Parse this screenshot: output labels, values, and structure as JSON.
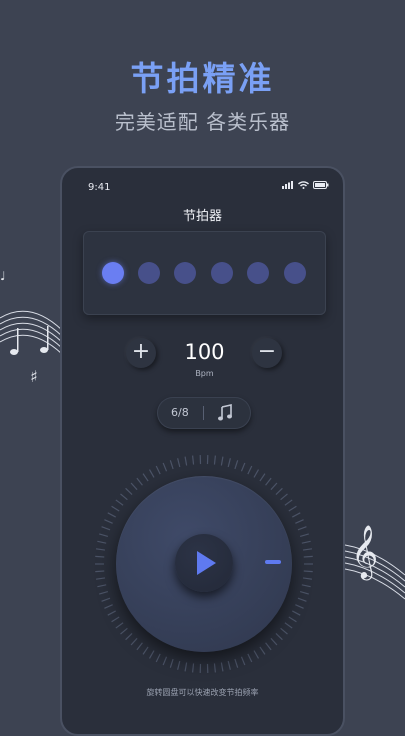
{
  "promo": {
    "title": "节拍精准",
    "subtitle": "完美适配 各类乐器"
  },
  "status": {
    "time": "9:41"
  },
  "app": {
    "title": "节拍器"
  },
  "beats": {
    "count": 6,
    "active_index": 0
  },
  "tempo": {
    "value": "100",
    "unit": "Bpm",
    "increase_label": "+",
    "decrease_label": "−"
  },
  "time_signature": {
    "value": "6/8",
    "icon": "music-note-icon"
  },
  "hint": "旋转圆盘可以快速改变节拍频率",
  "colors": {
    "accent": "#6a7ef2",
    "background": "#3d4352",
    "phone": "#2a2f3b",
    "title": "#7aa0f5"
  }
}
